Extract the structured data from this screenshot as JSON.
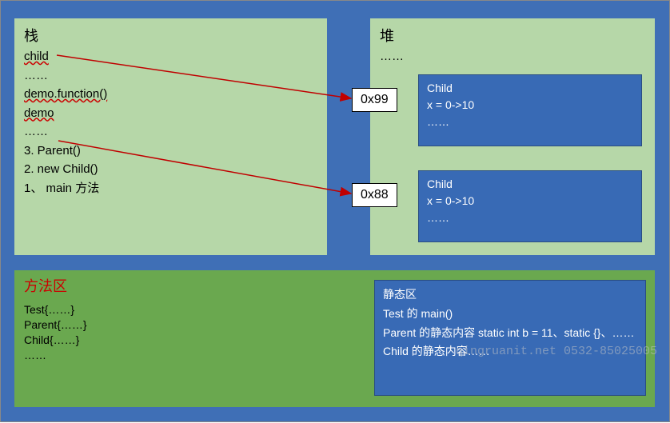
{
  "stack": {
    "title": "栈",
    "items": [
      {
        "text": "child",
        "underline": true
      },
      {
        "text": "……",
        "underline": false
      },
      {
        "text": "demo.function()",
        "underline": true
      },
      {
        "text": "demo",
        "underline": true
      },
      {
        "text": "……",
        "underline": false
      },
      {
        "text": "3. Parent()",
        "underline": false
      },
      {
        "text": "2. new Child()",
        "underline": false
      },
      {
        "text": "1、  main 方法",
        "underline": false
      }
    ]
  },
  "heap": {
    "title": "堆",
    "prefix": "……",
    "objects": [
      {
        "addr": "0x99",
        "name": "Child",
        "field": "x = 0->10",
        "rest": "……"
      },
      {
        "addr": "0x88",
        "name": "Child",
        "field": "x = 0->10",
        "rest": "……"
      }
    ]
  },
  "method_area": {
    "title": "方法区",
    "lines": [
      "Test{……}",
      "Parent{……}",
      "Child{……}",
      "……"
    ]
  },
  "static_area": {
    "title": "静态区",
    "lines": [
      "Test 的 main()",
      "Parent 的静态内容  static int b = 11、static {}、……",
      "Child 的静态内容……"
    ]
  },
  "arrows": [
    {
      "from": "child",
      "to_addr": "0x99"
    },
    {
      "from": "demo",
      "to_addr": "0x88"
    }
  ],
  "watermark": "qingruanit.net 0532-85025005"
}
